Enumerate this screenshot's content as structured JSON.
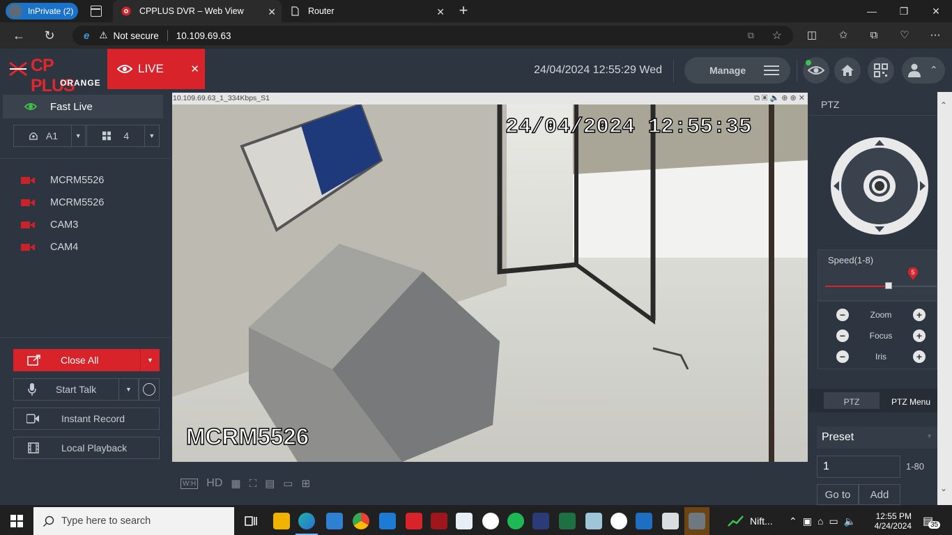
{
  "browser": {
    "inprivate_label": "InPrivate (2)",
    "tabs": [
      {
        "title": "CPPLUS DVR – Web View",
        "active": true
      },
      {
        "title": "Router",
        "active": false
      }
    ],
    "new_tab": "+",
    "address": {
      "security_label": "Not secure",
      "url": "10.109.69.63"
    }
  },
  "app": {
    "logo_text": "CP PLUS",
    "logo_sub": "ORANGE",
    "live_tab_label": "LIVE",
    "datetime": "24/04/2024 12:55:29 Wed",
    "manage_label": "Manage",
    "accent_color": "#d8232a"
  },
  "left_panel": {
    "fast_live_label": "Fast Live",
    "channel_select": "A1",
    "layout_select": "4",
    "cameras": [
      {
        "name": "MCRM5526"
      },
      {
        "name": "MCRM5526"
      },
      {
        "name": "CAM3"
      },
      {
        "name": "CAM4"
      }
    ],
    "buttons": {
      "close_all": "Close All",
      "start_talk": "Start Talk",
      "instant_record": "Instant Record",
      "local_playback": "Local Playback"
    }
  },
  "video": {
    "stream_title": "10.109.69.63_1_334Kbps_S1",
    "osd_datetime": "24/04/2024 12:55:35",
    "osd_camera_name": "MCRM5526",
    "toolbar": {
      "wh": "W:H",
      "hd": "HD"
    }
  },
  "ptz": {
    "header": "PTZ",
    "speed_label": "Speed(1-8)",
    "speed_value": "5",
    "speed_fraction": 0.57,
    "controls": [
      {
        "label": "Zoom"
      },
      {
        "label": "Focus"
      },
      {
        "label": "Iris"
      }
    ],
    "tabs": {
      "ptz": "PTZ",
      "menu": "PTZ Menu"
    },
    "preset_label": "Preset",
    "preset_number": "1",
    "preset_range": "1-80",
    "goto_label": "Go to",
    "add_label": "Add"
  },
  "taskbar": {
    "search_placeholder": "Type here to search",
    "stocks_label": "Nift...",
    "time": "12:55 PM",
    "date": "4/24/2024",
    "notification_count": "35"
  }
}
